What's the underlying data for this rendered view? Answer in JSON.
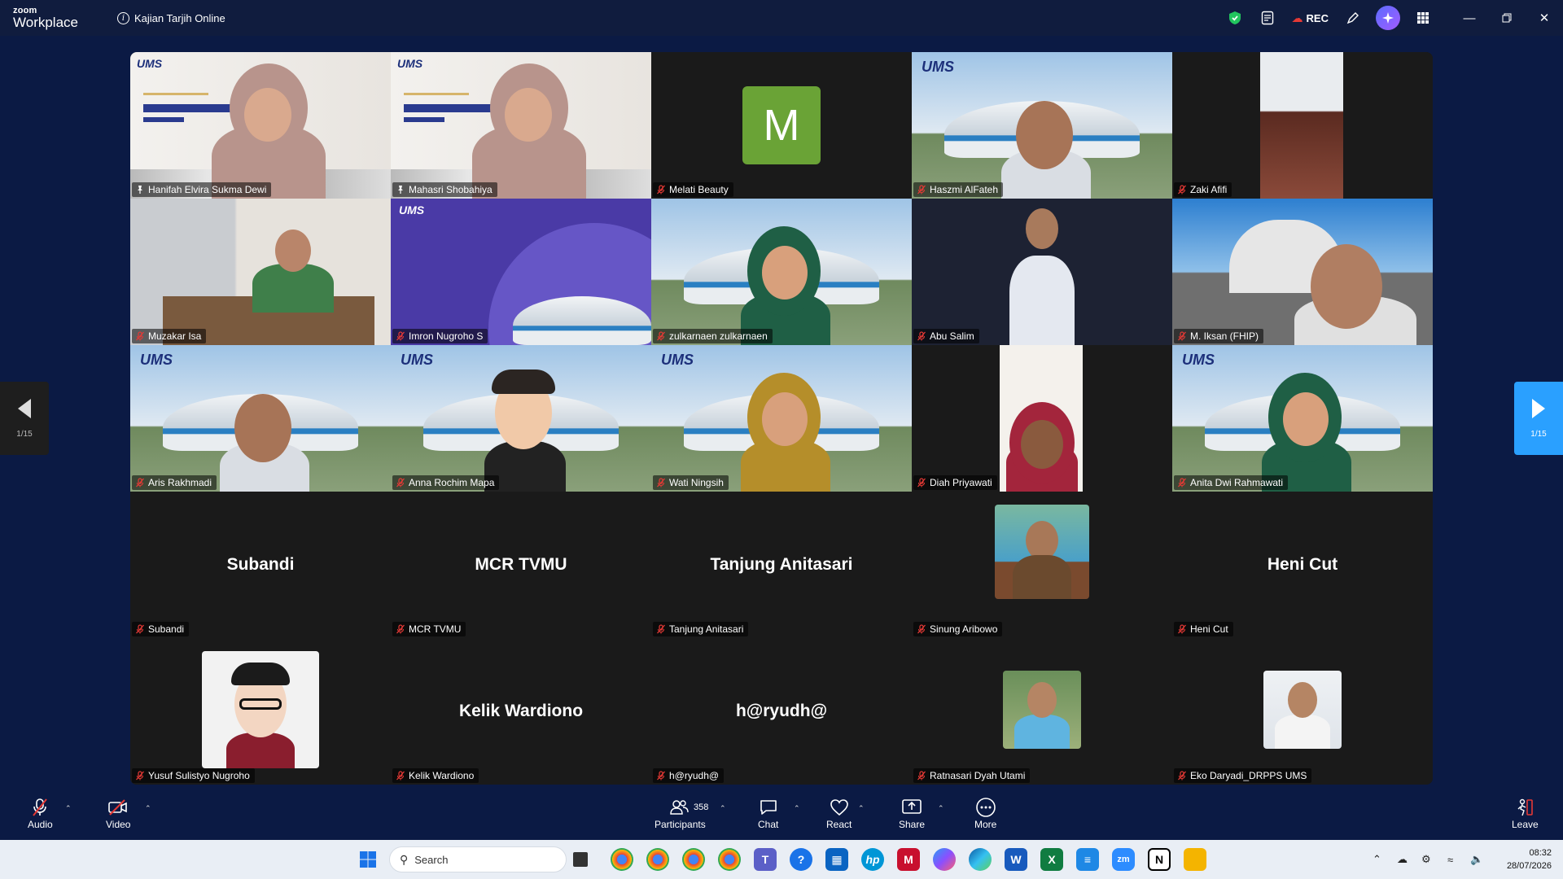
{
  "app": {
    "brand_top": "zoom",
    "brand_bottom": "Workplace",
    "meeting_title": "Kajian Tarjih Online",
    "rec_label": "REC"
  },
  "pagination": {
    "left_label": "1/15",
    "right_label": "1/15"
  },
  "participants": [
    {
      "name": "Hanifah Elvira Sukma Dewi",
      "pinned": true,
      "scene": "slide"
    },
    {
      "name": "Mahasri Shobahiya",
      "pinned": true,
      "active": true,
      "scene": "slide"
    },
    {
      "name": "Melati Beauty",
      "avatar_letter": "M",
      "scene": "letter"
    },
    {
      "name": "Haszmi AlFateh",
      "scene": "stadium-person"
    },
    {
      "name": "Zaki Afifi",
      "scene": "narrow"
    },
    {
      "name": "Muzakar Isa",
      "scene": "office"
    },
    {
      "name": "Imron Nugroho S",
      "scene": "purple"
    },
    {
      "name": "zulkarnaen zulkarnaen",
      "scene": "stadium"
    },
    {
      "name": "Abu Salim",
      "scene": "dark-person"
    },
    {
      "name": "M. Iksan (FHIP)",
      "scene": "mosque"
    },
    {
      "name": "Aris Rakhmadi",
      "scene": "stadium-person"
    },
    {
      "name": "Anna Rochim Mapa",
      "scene": "stadium-avatar"
    },
    {
      "name": "Wati Ningsih",
      "scene": "stadium-avatar-hijab"
    },
    {
      "name": "Diah Priyawati",
      "scene": "narrow-avatar"
    },
    {
      "name": "Anita Dwi Rahmawati",
      "scene": "stadium-avatar-hijab"
    },
    {
      "name": "Subandi",
      "display_name": "Subandi",
      "scene": "name-only"
    },
    {
      "name": "MCR TVMU",
      "display_name": "MCR TVMU",
      "scene": "name-only"
    },
    {
      "name": "Tanjung Anitasari",
      "display_name": "Tanjung Anitasari",
      "scene": "name-only"
    },
    {
      "name": "Sinung Aribowo",
      "scene": "profile"
    },
    {
      "name": "Heni Cut",
      "display_name": "Heni Cut",
      "scene": "name-only"
    },
    {
      "name": "Yusuf Sulistyo Nugroho",
      "scene": "profile-cartoon"
    },
    {
      "name": "Kelik Wardiono",
      "display_name": "Kelik Wardiono",
      "scene": "name-only"
    },
    {
      "name": "h@ryudh@",
      "display_name": "h@ryudh@",
      "scene": "name-only"
    },
    {
      "name": "Ratnasari Dyah Utami",
      "scene": "profile-small"
    },
    {
      "name": "Eko Daryadi_DRPPS UMS",
      "scene": "profile-small"
    }
  ],
  "toolbar": {
    "audio_label": "Audio",
    "video_label": "Video",
    "participants_label": "Participants",
    "participants_count": "358",
    "chat_label": "Chat",
    "react_label": "React",
    "share_label": "Share",
    "more_label": "More",
    "leave_label": "Leave"
  },
  "taskbar": {
    "search_placeholder": "Search",
    "time": "08:32",
    "date": "28/07/2026"
  },
  "colors": {
    "accent": "#2aa0ff",
    "active_speaker": "#35e0a5",
    "muted": "#e53935",
    "background": "#0b1a44"
  }
}
